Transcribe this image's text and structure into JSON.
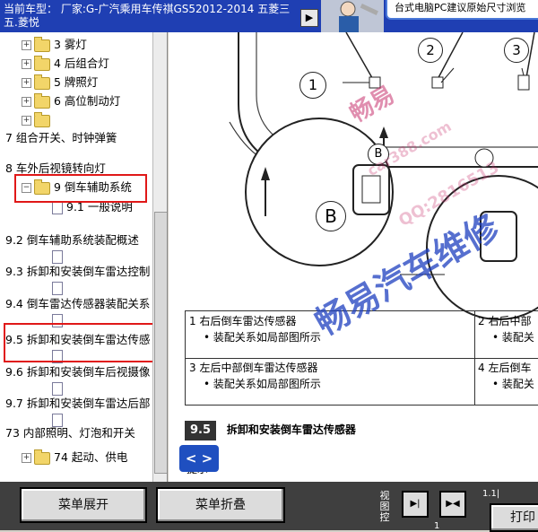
{
  "title": {
    "text": "当前车型： 厂家:G-广汽乘用车传祺GS52012-2014 五菱三五.菱悦",
    "arrow": "▶",
    "notice": "台式电脑PC建议原始尺寸浏览"
  },
  "tree": {
    "items": [
      {
        "label": "3 雾灯",
        "type": "folder"
      },
      {
        "label": "4 后组合灯",
        "type": "folder"
      },
      {
        "label": "5 牌照灯",
        "type": "folder"
      },
      {
        "label": "6 高位制动灯",
        "type": "folder"
      },
      {
        "label": "",
        "type": "folder"
      },
      {
        "label": "7 组合开关、时钟弹簧",
        "type": "text"
      },
      {
        "label": "8 车外后视镜转向灯",
        "type": "text"
      },
      {
        "label": "9 倒车辅助系统",
        "type": "open-folder"
      },
      {
        "label": "9.1 一般说明",
        "type": "doc"
      },
      {
        "label": "9.2 倒车辅助系统装配概述",
        "type": "text"
      },
      {
        "label": "9.3 拆卸和安装倒车雷达控制",
        "type": "text"
      },
      {
        "label": "9.4 倒车雷达传感器装配关系",
        "type": "text"
      },
      {
        "label": "9.5 拆卸和安装倒车雷达传感",
        "type": "text"
      },
      {
        "label": "9.6 拆卸和安装倒车后视摄像",
        "type": "text"
      },
      {
        "label": "9.7 拆卸和安装倒车雷达后部",
        "type": "text"
      },
      {
        "label": "73 内部照明、灯泡和开关",
        "type": "text"
      },
      {
        "label": "74 起动、供电",
        "type": "folder"
      }
    ]
  },
  "diagram": {
    "callouts": [
      "1",
      "2",
      "3"
    ],
    "detail_label": "B"
  },
  "captions": {
    "c1": "1  右后倒车雷达传感器",
    "c1_sub": "•  装配关系如局部图所示",
    "c2": "2  右后中部",
    "c2_sub": "•  装配关",
    "c3": "3  左后中部倒车雷达传感器",
    "c3_sub": "•  装配关系如局部图所示",
    "c4": "4  左后倒车",
    "c4_sub": "•  装配关"
  },
  "section": {
    "number": "9.5",
    "title": "拆卸和安装倒车雷达传感器",
    "hint": "提示"
  },
  "watermarks": {
    "w1": "畅易汽车维修",
    "w2": "畅易",
    "w3": "car388.com",
    "w4": "QQ:2816513"
  },
  "nav_button": "< >",
  "bottom": {
    "expand_label": "菜单展开",
    "collapse_label": "菜单折叠",
    "view_label": "视图控",
    "print_label": "打印",
    "page_indicator": "1.1|",
    "page_number": "1"
  },
  "colors": {
    "title_bg": "#1f3fb3",
    "highlight": "#e01818",
    "watermark": "#c8326e",
    "nav_button": "#1f4fc0"
  }
}
